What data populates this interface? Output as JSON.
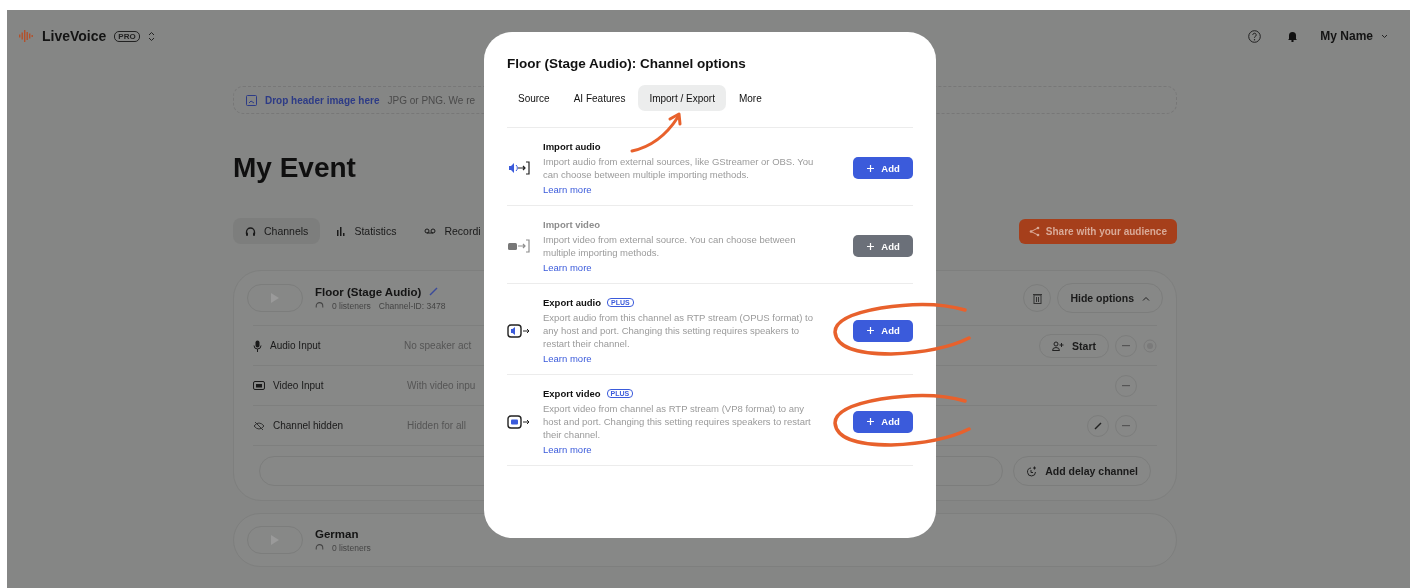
{
  "app": {
    "name": "LiveVoice",
    "plan_badge": "PRO"
  },
  "header": {
    "user_name": "My Name"
  },
  "header_image_drop": {
    "link": "Drop header image here",
    "hint": "JPG or PNG. We re"
  },
  "event_title": "My Event",
  "nav_tabs": [
    {
      "kind": "channels",
      "label": "Channels",
      "selected": true
    },
    {
      "kind": "statistics",
      "label": "Statistics",
      "selected": false
    },
    {
      "kind": "recordings",
      "label": "Recordi",
      "selected": false
    }
  ],
  "share_button": "Share with your audience",
  "channels": [
    {
      "name": "Floor (Stage Audio)",
      "listeners": "0 listeners",
      "channel_id": "Channel-ID: 3478",
      "expanded": true,
      "options_button": "Hide options",
      "options": [
        {
          "kind": "audio",
          "label": "Audio Input",
          "value": "No speaker act",
          "action": "Start"
        },
        {
          "kind": "video",
          "label": "Video Input",
          "value": "With video inpu"
        },
        {
          "kind": "hidden",
          "label": "Channel hidden",
          "value": "Hidden for all"
        }
      ],
      "delay_button": "Add delay channel"
    },
    {
      "name": "German",
      "listeners": "0 listeners",
      "expanded": false
    }
  ],
  "dialog": {
    "title": "Floor (Stage Audio): Channel options",
    "tabs": [
      {
        "label": "Source",
        "selected": false,
        "annotated": false
      },
      {
        "label": "AI Features",
        "selected": false,
        "annotated": false
      },
      {
        "label": "Import / Export",
        "selected": true,
        "annotated": true
      },
      {
        "label": "More",
        "selected": false,
        "annotated": false
      }
    ],
    "sections": [
      {
        "kind": "import-audio",
        "title": "Import audio",
        "description": "Import audio from external sources, like GStreamer or OBS. You can choose between multiple importing methods.",
        "link": "Learn more",
        "button": "Add",
        "disabled": false,
        "circled": false
      },
      {
        "kind": "import-video",
        "title": "Import video",
        "description": "Import video from external source. You can choose between multiple importing methods.",
        "link": "Learn more",
        "button": "Add",
        "disabled": true,
        "circled": false
      },
      {
        "kind": "export-audio",
        "title": "Export audio",
        "badge": "PLUS",
        "description": "Export audio from this channel as RTP stream (OPUS format) to any host and port. Changing this setting requires speakers to restart their channel.",
        "link": "Learn more",
        "button": "Add",
        "disabled": false,
        "circled": true
      },
      {
        "kind": "export-video",
        "title": "Export video",
        "badge": "PLUS",
        "description": "Export video from channel as RTP stream (VP8 format) to any host and port. Changing this setting requires speakers to restart their channel.",
        "link": "Learn more",
        "button": "Add",
        "disabled": false,
        "circled": true
      }
    ]
  }
}
